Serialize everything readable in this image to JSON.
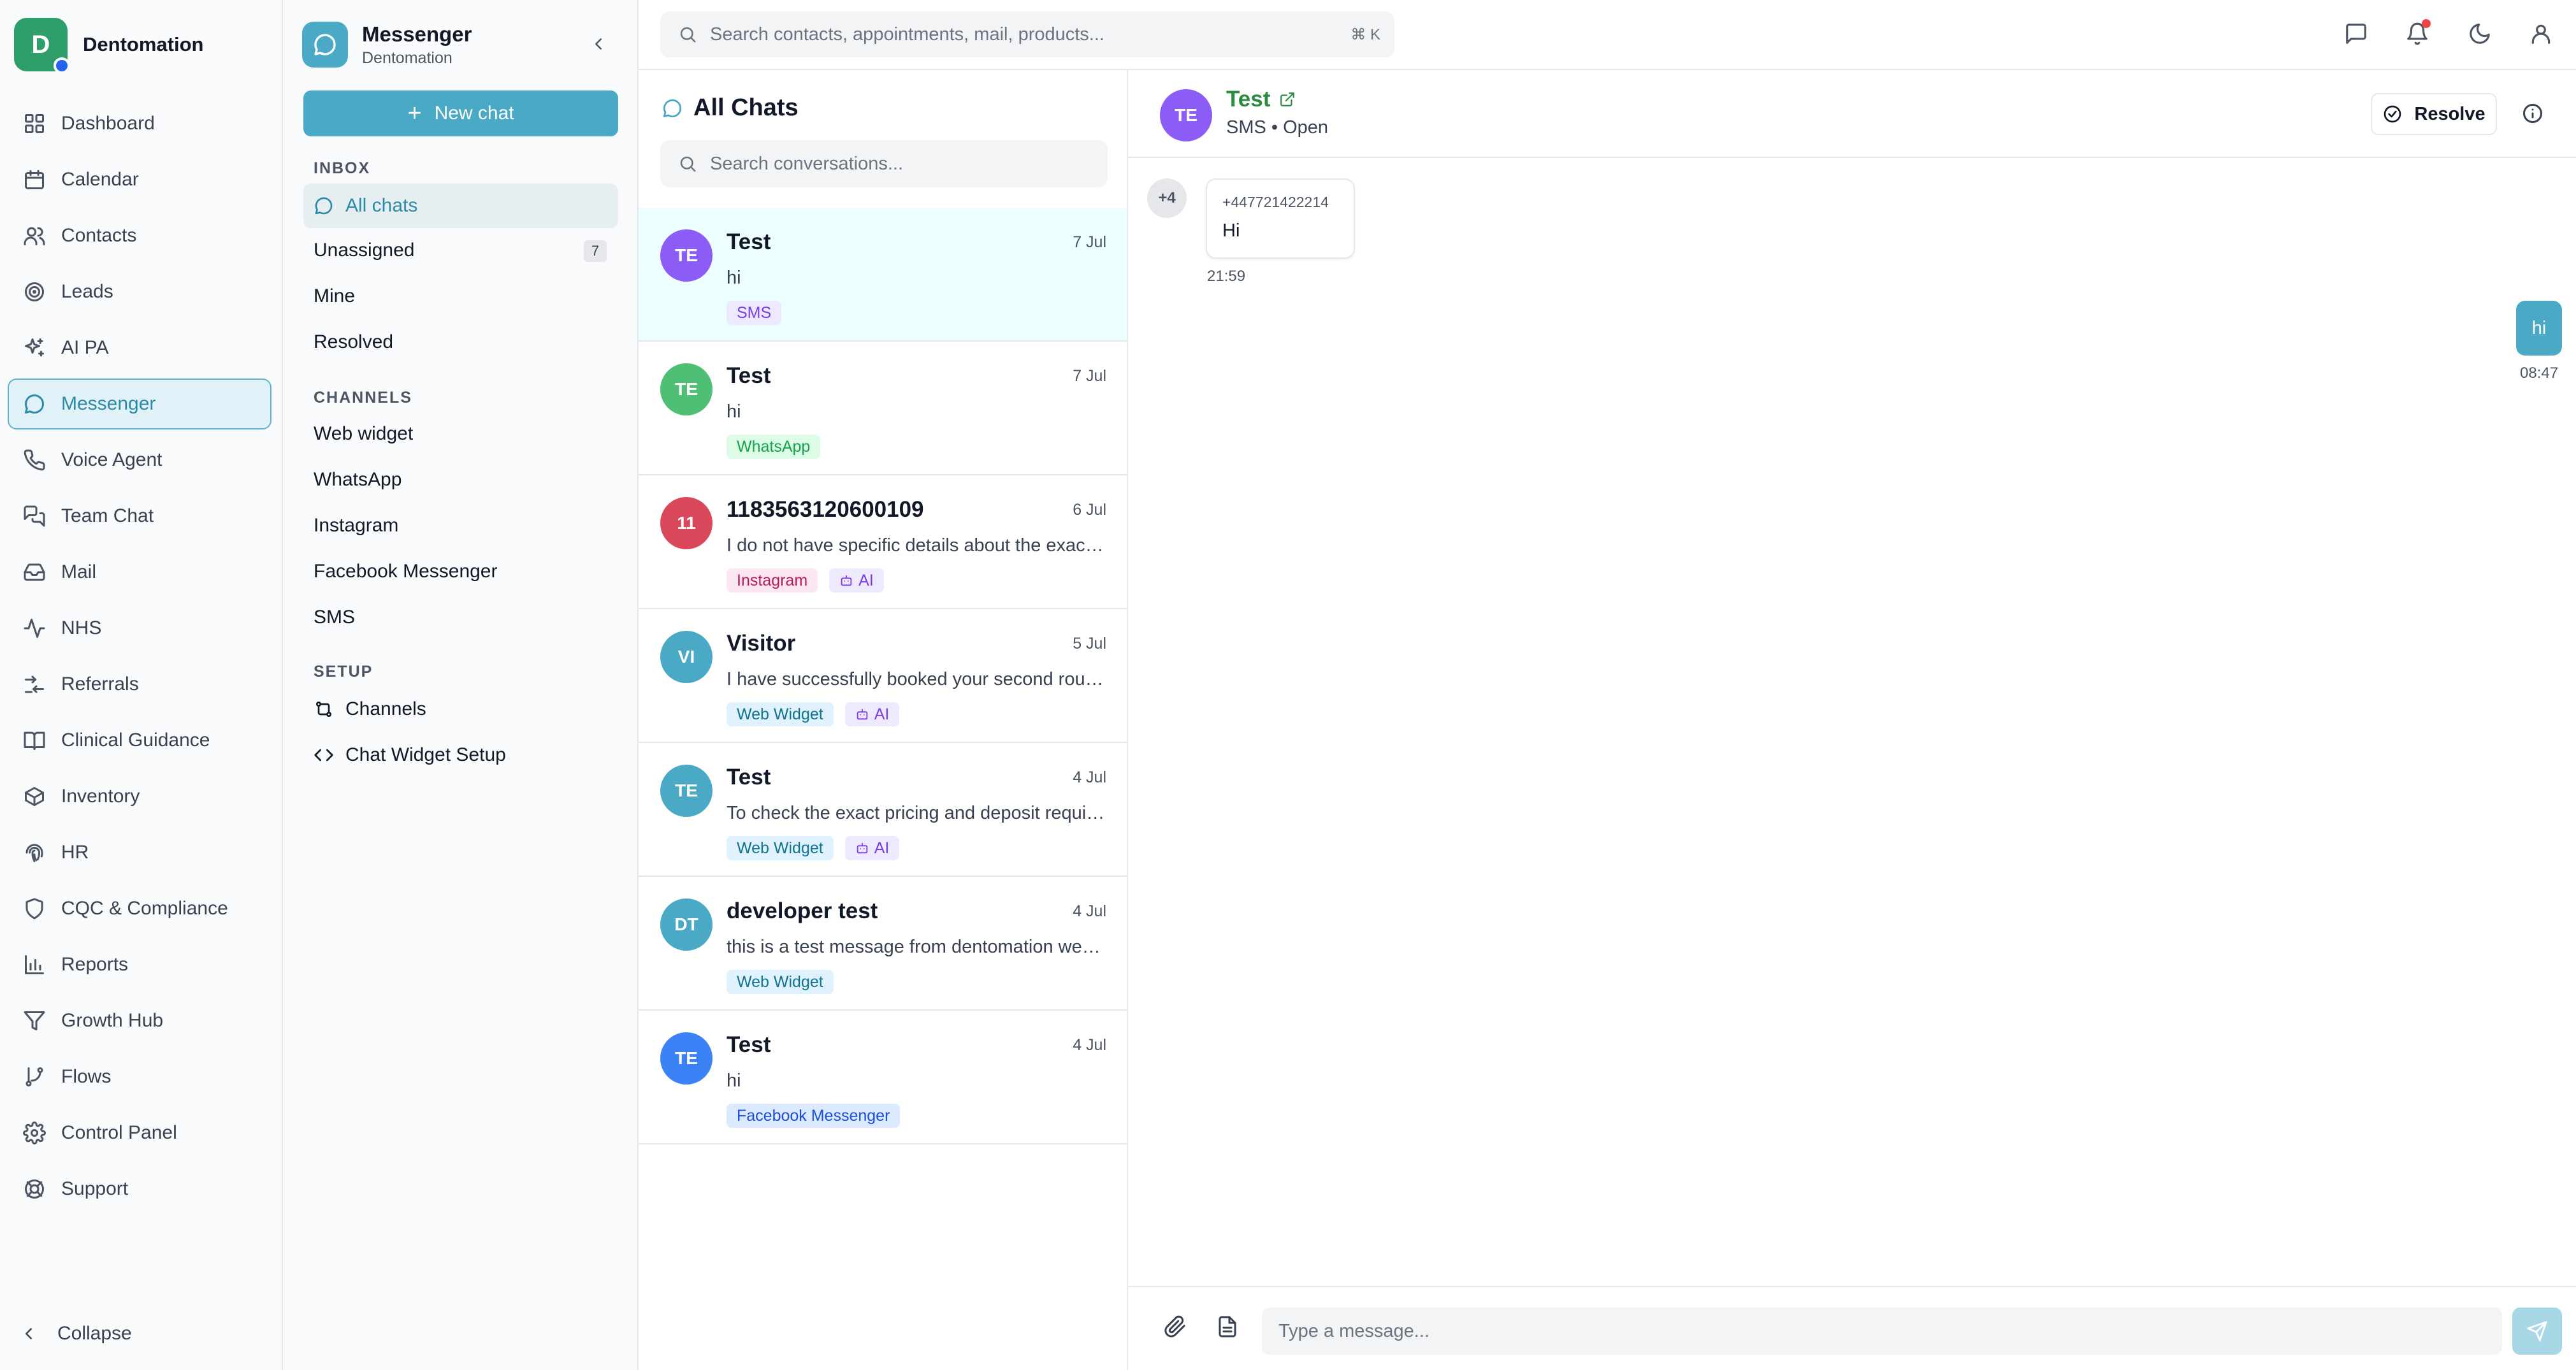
{
  "brand": {
    "initial": "D",
    "name": "Dentomation"
  },
  "sidebar": {
    "items": [
      {
        "label": "Dashboard",
        "icon": "dashboard-icon"
      },
      {
        "label": "Calendar",
        "icon": "calendar-icon"
      },
      {
        "label": "Contacts",
        "icon": "contacts-icon"
      },
      {
        "label": "Leads",
        "icon": "target-icon"
      },
      {
        "label": "AI PA",
        "icon": "sparkles-icon"
      },
      {
        "label": "Messenger",
        "icon": "chat-bubble-icon",
        "active": true
      },
      {
        "label": "Voice Agent",
        "icon": "phone-icon"
      },
      {
        "label": "Team Chat",
        "icon": "team-chat-icon"
      },
      {
        "label": "Mail",
        "icon": "mail-icon"
      },
      {
        "label": "NHS",
        "icon": "activity-icon"
      },
      {
        "label": "Referrals",
        "icon": "referrals-icon"
      },
      {
        "label": "Clinical Guidance",
        "icon": "book-icon"
      },
      {
        "label": "Inventory",
        "icon": "package-icon"
      },
      {
        "label": "HR",
        "icon": "fingerprint-icon"
      },
      {
        "label": "CQC & Compliance",
        "icon": "shield-icon"
      },
      {
        "label": "Reports",
        "icon": "bar-chart-icon"
      },
      {
        "label": "Growth Hub",
        "icon": "funnel-icon"
      },
      {
        "label": "Flows",
        "icon": "git-branch-icon"
      },
      {
        "label": "Control Panel",
        "icon": "gear-icon"
      },
      {
        "label": "Support",
        "icon": "help-icon"
      }
    ],
    "collapse_label": "Collapse"
  },
  "messenger": {
    "title": "Messenger",
    "subtitle": "Dentomation",
    "new_chat_label": "New chat",
    "inbox_label": "INBOX",
    "inbox": [
      {
        "label": "All chats",
        "active": true
      },
      {
        "label": "Unassigned",
        "count": "7"
      },
      {
        "label": "Mine"
      },
      {
        "label": "Resolved"
      }
    ],
    "channels_label": "CHANNELS",
    "channels": [
      "Web widget",
      "WhatsApp",
      "Instagram",
      "Facebook Messenger",
      "SMS"
    ],
    "setup_label": "SETUP",
    "setup": [
      {
        "label": "Channels",
        "icon": "channels-icon"
      },
      {
        "label": "Chat Widget Setup",
        "icon": "code-icon"
      }
    ]
  },
  "topbar": {
    "search_placeholder": "Search contacts, appointments, mail, products...",
    "shortcut": "⌘ K"
  },
  "chat_list": {
    "title": "All Chats",
    "search_placeholder": "Search conversations...",
    "conversations": [
      {
        "initials": "TE",
        "color": "#8b5cf6",
        "name": "Test",
        "date": "7 Jul",
        "preview": "hi",
        "tags": [
          {
            "label": "SMS",
            "kind": "sms"
          }
        ],
        "active": true
      },
      {
        "initials": "TE",
        "color": "#4ebf75",
        "name": "Test",
        "date": "7 Jul",
        "preview": "hi",
        "tags": [
          {
            "label": "WhatsApp",
            "kind": "whatsapp"
          }
        ]
      },
      {
        "initials": "11",
        "color": "#d9475a",
        "name": "1183563120600109",
        "date": "6 Jul",
        "preview": "I do not have specific details about the exact pricing",
        "tags": [
          {
            "label": "Instagram",
            "kind": "instagram"
          },
          {
            "label": "AI",
            "kind": "ai"
          }
        ]
      },
      {
        "initials": "VI",
        "color": "#4aaac5",
        "name": "Visitor",
        "date": "5 Jul",
        "preview": "I have successfully booked your second routine check-up",
        "tags": [
          {
            "label": "Web Widget",
            "kind": "web"
          },
          {
            "label": "AI",
            "kind": "ai"
          }
        ]
      },
      {
        "initials": "TE",
        "color": "#4aaac5",
        "name": "Test",
        "date": "4 Jul",
        "preview": "To check the exact pricing and deposit requirements",
        "tags": [
          {
            "label": "Web Widget",
            "kind": "web"
          },
          {
            "label": "AI",
            "kind": "ai"
          }
        ]
      },
      {
        "initials": "DT",
        "color": "#4aaac5",
        "name": "developer test",
        "date": "4 Jul",
        "preview": "this is a test message from dentomation website widget",
        "tags": [
          {
            "label": "Web Widget",
            "kind": "web"
          }
        ]
      },
      {
        "initials": "TE",
        "color": "#3b82f6",
        "name": "Test",
        "date": "4 Jul",
        "preview": "hi",
        "tags": [
          {
            "label": "Facebook Messenger",
            "kind": "facebook"
          }
        ]
      }
    ]
  },
  "conversation": {
    "initials": "TE",
    "name": "Test",
    "meta": "SMS • Open",
    "resolve_label": "Resolve",
    "more_count": "+4",
    "incoming": {
      "sender": "+447721422214",
      "text": "Hi",
      "time": "21:59"
    },
    "outgoing": {
      "text": "hi",
      "time": "08:47"
    },
    "composer_placeholder": "Type a message..."
  },
  "tag_styles": {
    "sms": {
      "bg": "#ede9fe",
      "fg": "#7c3aed"
    },
    "whatsapp": {
      "bg": "#dcfce7",
      "fg": "#16a34a"
    },
    "instagram": {
      "bg": "#fce7f3",
      "fg": "#be185d"
    },
    "ai": {
      "bg": "#ede9fe",
      "fg": "#7c3aed"
    },
    "web": {
      "bg": "#e0f2fe",
      "fg": "#0e7490"
    },
    "facebook": {
      "bg": "#dbeafe",
      "fg": "#1d4ed8"
    }
  }
}
